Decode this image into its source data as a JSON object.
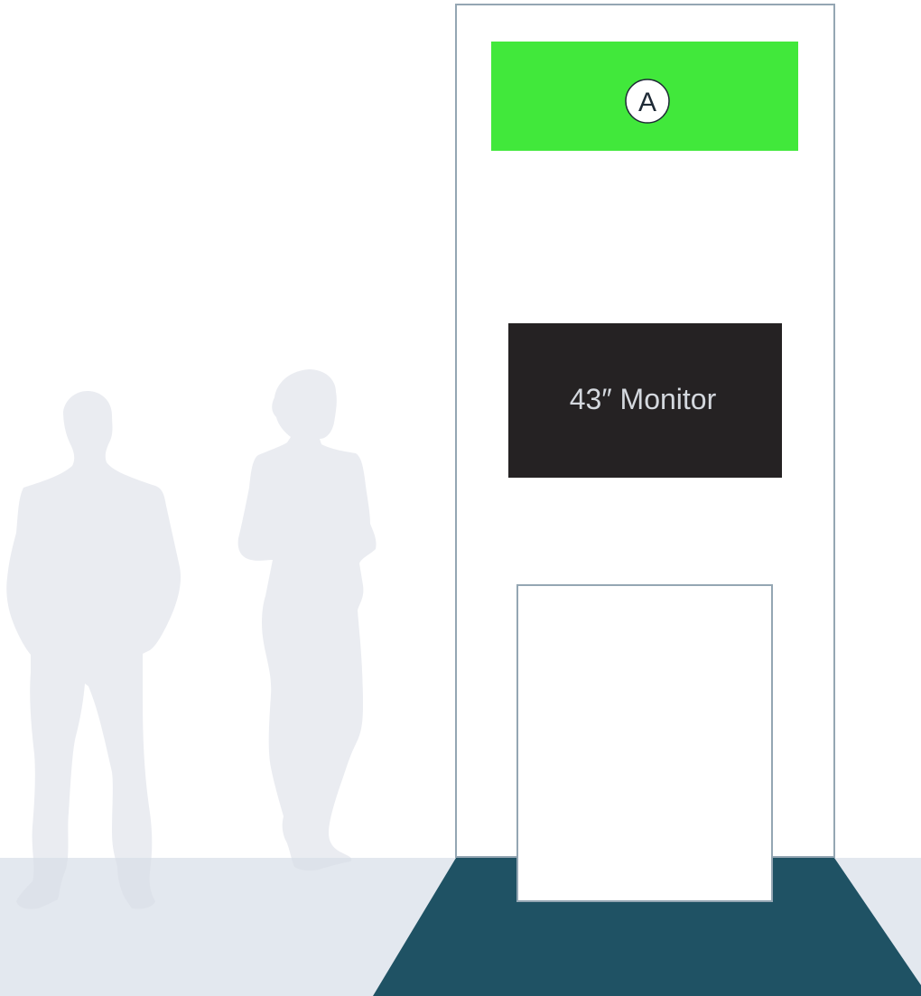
{
  "sign_header": {
    "marker_letter": "A",
    "color": "#41e83b"
  },
  "monitor": {
    "label": "43″ Monitor",
    "color": "#252223",
    "text_color": "#d4d8de"
  },
  "colors": {
    "floor": "#e3e8ef",
    "carpet": "#1f5264",
    "outline": "#94a6b3",
    "silhouette": "#eceef1",
    "marker_stroke": "#1e2a36"
  },
  "icons": {
    "people": "people-silhouettes-icon"
  }
}
